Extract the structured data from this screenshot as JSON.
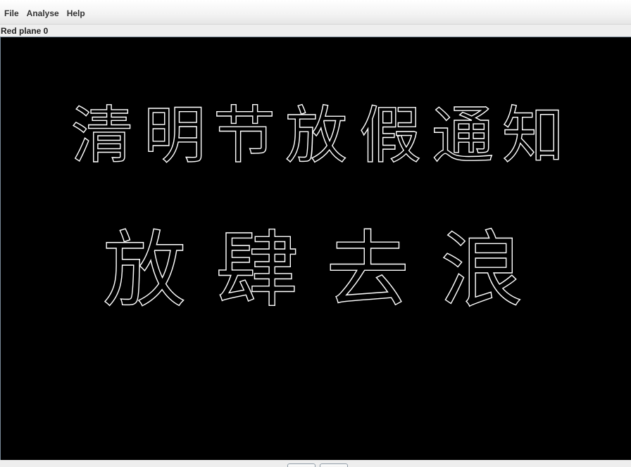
{
  "menubar": {
    "items": [
      {
        "label": "File"
      },
      {
        "label": "Analyse"
      },
      {
        "label": "Help"
      }
    ]
  },
  "status": {
    "plane_label": "Red plane 0"
  },
  "image": {
    "line1": [
      "清",
      "明",
      "节",
      "放",
      "假",
      "通",
      "知"
    ],
    "line2": [
      "放",
      "肆",
      "去",
      "浪"
    ],
    "colors": {
      "background": "#000000",
      "edges": "#ffffff"
    }
  },
  "bottom": {
    "prev_icon": "prev-button",
    "next_icon": "next-button"
  }
}
